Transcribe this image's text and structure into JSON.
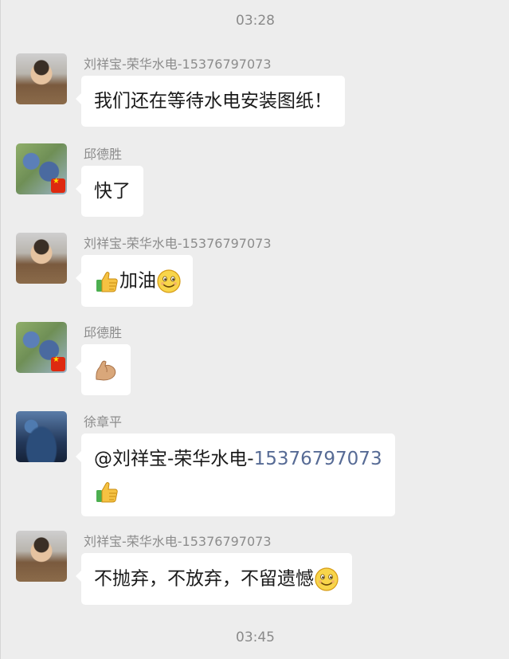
{
  "timestamps": {
    "top": "03:28",
    "bottom": "03:45"
  },
  "messages": [
    {
      "sender": "刘祥宝-荣华水电-15376797073",
      "text": "我们还在等待水电安装图纸！",
      "avatar": "child-avatar"
    },
    {
      "sender": "邱德胜",
      "text": "快了",
      "avatar": "flower-avatar-with-flag"
    },
    {
      "sender": "刘祥宝-荣华水电-15376797073",
      "text": "加油",
      "avatar": "child-avatar",
      "emojis": [
        "thumbs-up-emoji",
        "smile-emoji"
      ]
    },
    {
      "sender": "邱德胜",
      "text": "",
      "avatar": "flower-avatar-with-flag",
      "emojis": [
        "flexed-biceps-emoji"
      ]
    },
    {
      "sender": "徐章平",
      "text_prefix": "@刘祥宝-荣华水电-",
      "text_number": "15376797073",
      "avatar": "aquarium-avatar",
      "emojis": [
        "thumbs-up-emoji"
      ]
    },
    {
      "sender": "刘祥宝-荣华水电-15376797073",
      "text": "不抛弃，不放弃，不留遗憾",
      "avatar": "child-avatar",
      "emojis": [
        "smile-emoji"
      ]
    }
  ],
  "colors": {
    "background": "#ededed",
    "bubble": "#ffffff",
    "mention_link": "#576b95",
    "meta_text": "#8c8c8c"
  }
}
